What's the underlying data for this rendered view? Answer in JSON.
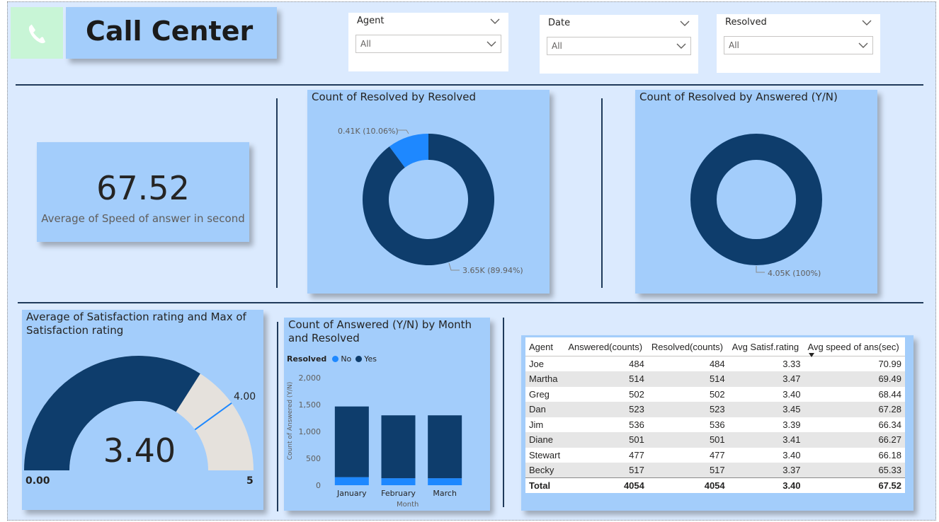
{
  "header": {
    "title": "Call Center",
    "phone_icon": "phone-icon"
  },
  "slicers": [
    {
      "title": "Agent",
      "value": "All"
    },
    {
      "title": "Date",
      "value": "All"
    },
    {
      "title": "Resolved",
      "value": "All"
    }
  ],
  "kpi": {
    "value": "67.52",
    "label": "Average of Speed of answer in second"
  },
  "donut1": {
    "title": "Count of Resolved by Resolved",
    "chart_data": {
      "type": "pie",
      "slices": [
        {
          "label": "0.41K (10.06%)",
          "value": 410,
          "percent": 10.06,
          "color": "#1e88ff"
        },
        {
          "label": "3.65K (89.94%)",
          "value": 3650,
          "percent": 89.94,
          "color": "#0e3d6c"
        }
      ]
    }
  },
  "donut2": {
    "title": "Count of Resolved by Answered (Y/N)",
    "chart_data": {
      "type": "pie",
      "slices": [
        {
          "label": "4.05K (100%)",
          "value": 4050,
          "percent": 100,
          "color": "#0e3d6c"
        }
      ]
    }
  },
  "gauge": {
    "title": "Average of Satisfaction rating and Max of Satisfaction rating",
    "value_label": "3.40",
    "min_label": "0.00",
    "max_label": "5",
    "target_label": "4.00",
    "chart_data": {
      "type": "gauge",
      "value": 3.4,
      "target": 4.0,
      "min": 0,
      "max": 5,
      "fill_color": "#0e3d6c",
      "track_color": "#e5e1dc",
      "target_color": "#1e88ff"
    }
  },
  "barchart": {
    "title": "Count of Answered (Y/N) by Month and Resolved",
    "legend_title": "Resolved",
    "ylabel": "Count of Answered (Y/N)",
    "xlabel": "Month",
    "y_ticks": [
      "2,000",
      "1,500",
      "1,000",
      "500",
      "0"
    ],
    "chart_data": {
      "type": "bar",
      "stacked": true,
      "categories": [
        "January",
        "February",
        "March"
      ],
      "series": [
        {
          "name": "No",
          "values": [
            150,
            130,
            130
          ],
          "color": "#1e88ff"
        },
        {
          "name": "Yes",
          "values": [
            1315,
            1170,
            1170
          ],
          "color": "#0e3d6c"
        }
      ],
      "ylim": [
        0,
        2000
      ],
      "legend": "top-left"
    }
  },
  "table": {
    "columns": [
      "Agent",
      "Answered(counts)",
      "Resolved(counts)",
      "Avg Satisf.rating",
      "Avg speed of ans(sec)"
    ],
    "rows": [
      [
        "Joe",
        "484",
        "484",
        "3.33",
        "70.99"
      ],
      [
        "Martha",
        "514",
        "514",
        "3.47",
        "69.49"
      ],
      [
        "Greg",
        "502",
        "502",
        "3.40",
        "68.44"
      ],
      [
        "Dan",
        "523",
        "523",
        "3.45",
        "67.28"
      ],
      [
        "Jim",
        "536",
        "536",
        "3.39",
        "66.34"
      ],
      [
        "Diane",
        "501",
        "501",
        "3.41",
        "66.27"
      ],
      [
        "Stewart",
        "477",
        "477",
        "3.40",
        "66.18"
      ],
      [
        "Becky",
        "517",
        "517",
        "3.37",
        "65.33"
      ]
    ],
    "total": [
      "Total",
      "4054",
      "4054",
      "3.40",
      "67.52"
    ],
    "sort_column": "Avg speed of ans(sec)"
  }
}
